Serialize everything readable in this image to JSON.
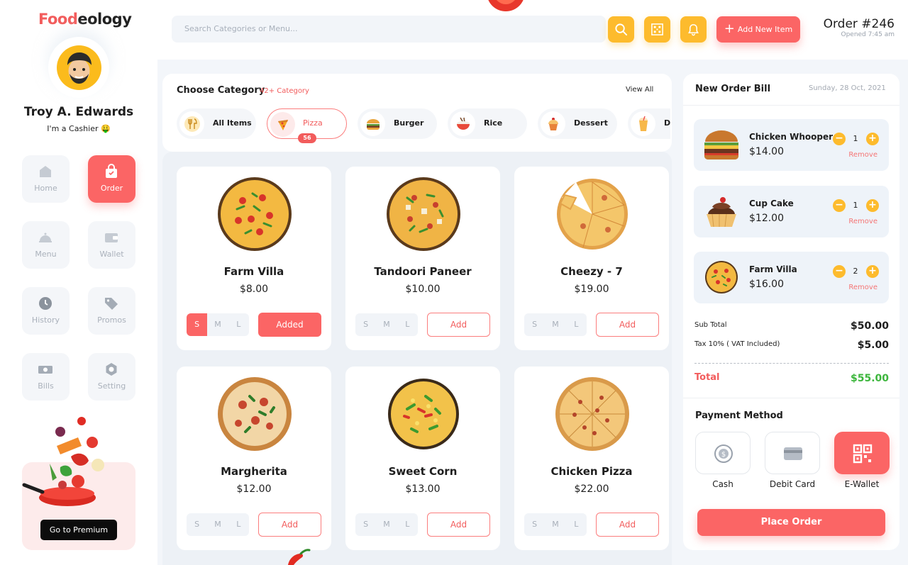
{
  "brand": {
    "part1": "Food",
    "part2": "eology"
  },
  "search": {
    "placeholder": "Search Categories or Menu..."
  },
  "header": {
    "add_new_item": "Add New Item",
    "order_number": "Order #246",
    "order_opened": "Opened 7:45 am",
    "icons": [
      "search-icon",
      "qr-icon",
      "bell-icon"
    ]
  },
  "user": {
    "name": "Troy A. Edwards",
    "role": "I'm a Cashier 🤑"
  },
  "nav": [
    {
      "label": "Home",
      "icon": "home-icon",
      "active": false
    },
    {
      "label": "Order",
      "icon": "shopping-bag-icon",
      "active": true
    },
    {
      "label": "Menu",
      "icon": "cloche-icon",
      "active": false
    },
    {
      "label": "Wallet",
      "icon": "wallet-icon",
      "active": false
    },
    {
      "label": "History",
      "icon": "clock-icon",
      "active": false
    },
    {
      "label": "Promos",
      "icon": "tag-icon",
      "active": false
    },
    {
      "label": "Bills",
      "icon": "cash-icon",
      "active": false
    },
    {
      "label": "Setting",
      "icon": "gear-icon",
      "active": false
    }
  ],
  "premium": {
    "button": "Go to Premium"
  },
  "categories": {
    "title": "Choose Category",
    "count_label": "42+ Category",
    "view_all": "View All",
    "active_badge": "56",
    "items": [
      {
        "name": "All Items",
        "icon": "cutlery-icon",
        "active": false
      },
      {
        "name": "Pizza",
        "icon": "pizza-slice-icon",
        "active": true
      },
      {
        "name": "Burger",
        "icon": "burger-icon",
        "active": false
      },
      {
        "name": "Rice",
        "icon": "rice-bowl-icon",
        "active": false
      },
      {
        "name": "Dessert",
        "icon": "cupcake-icon",
        "active": false
      },
      {
        "name": "D",
        "icon": "drink-icon",
        "active": false
      }
    ]
  },
  "products": [
    {
      "name": "Farm Villa",
      "price": "$8.00",
      "sizes": [
        "S",
        "M",
        "L"
      ],
      "selected_size": "S",
      "button": "Added",
      "added": true
    },
    {
      "name": "Tandoori Paneer",
      "price": "$10.00",
      "sizes": [
        "S",
        "M",
        "L"
      ],
      "selected_size": "",
      "button": "Add",
      "added": false
    },
    {
      "name": "Cheezy - 7",
      "price": "$19.00",
      "sizes": [
        "S",
        "M",
        "L"
      ],
      "selected_size": "",
      "button": "Add",
      "added": false
    },
    {
      "name": "Margherita",
      "price": "$12.00",
      "sizes": [
        "S",
        "M",
        "L"
      ],
      "selected_size": "",
      "button": "Add",
      "added": false
    },
    {
      "name": "Sweet Corn",
      "price": "$13.00",
      "sizes": [
        "S",
        "M",
        "L"
      ],
      "selected_size": "",
      "button": "Add",
      "added": false
    },
    {
      "name": "Chicken Pizza",
      "price": "$22.00",
      "sizes": [
        "S",
        "M",
        "L"
      ],
      "selected_size": "",
      "button": "Add",
      "added": false
    }
  ],
  "bill": {
    "title": "New Order Bill",
    "date": "Sunday, 28 Oct, 2021",
    "items": [
      {
        "name": "Chicken Whooper",
        "price": "$14.00",
        "qty": "1",
        "remove": "Remove"
      },
      {
        "name": "Cup Cake",
        "price": "$12.00",
        "qty": "1",
        "remove": "Remove"
      },
      {
        "name": "Farm Villa",
        "price": "$16.00",
        "qty": "2",
        "remove": "Remove"
      }
    ],
    "subtotal_label": "Sub Total",
    "subtotal": "$50.00",
    "tax_label": "Tax 10% ( VAT Included)",
    "tax": "$5.00",
    "total_label": "Total",
    "total": "$55.00"
  },
  "payment": {
    "title": "Payment Method",
    "methods": [
      {
        "label": "Cash",
        "icon": "coin-icon",
        "active": false
      },
      {
        "label": "Debit Card",
        "icon": "card-icon",
        "active": false
      },
      {
        "label": "E-Wallet",
        "icon": "qr-code-icon",
        "active": true
      }
    ],
    "place_order": "Place Order"
  },
  "colors": {
    "accent": "#fb6565",
    "yellow": "#fdbb2d",
    "green": "#3db63d"
  }
}
